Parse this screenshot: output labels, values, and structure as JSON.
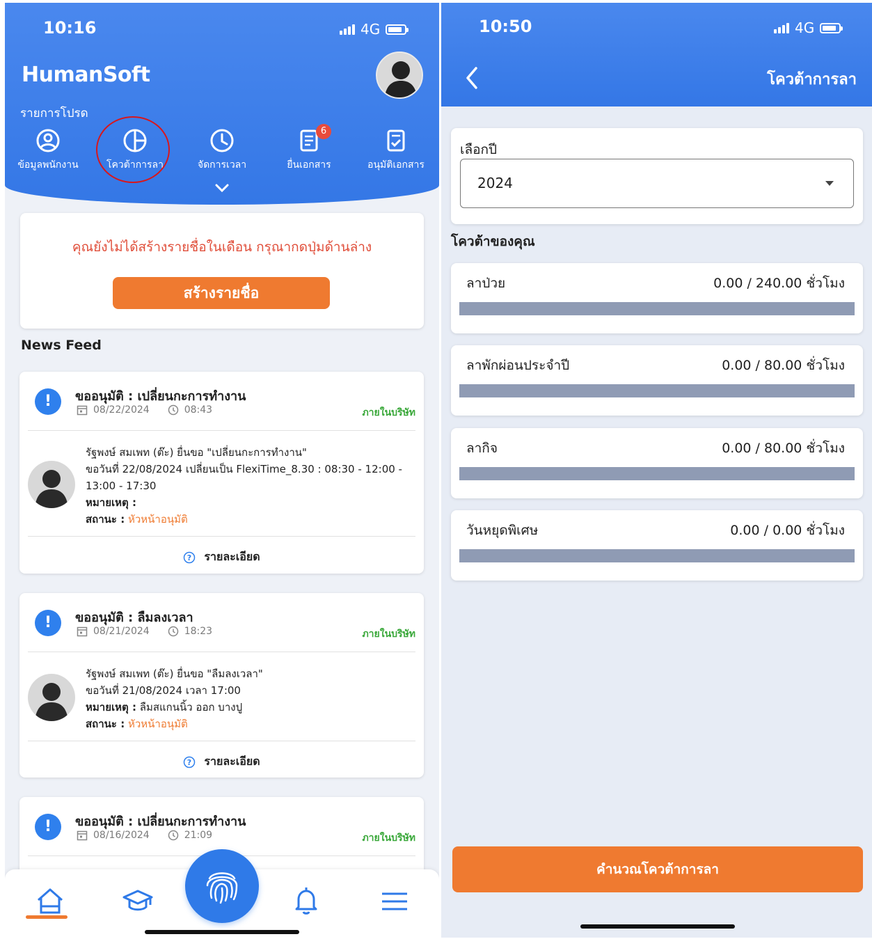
{
  "left": {
    "status": {
      "time": "10:16",
      "network": "4G"
    },
    "brand": "HumanSoft",
    "favorites_label": "รายการโปรด",
    "quick_menu": [
      {
        "label": "ข้อมูลพนักงาน",
        "icon": "user-circle-icon"
      },
      {
        "label": "โควต้าการลา",
        "icon": "pie-chart-icon"
      },
      {
        "label": "จัดการเวลา",
        "icon": "clock-icon"
      },
      {
        "label": "ยื่นเอกสาร",
        "icon": "document-icon",
        "badge": "6"
      },
      {
        "label": "อนุมัติเอกสาร",
        "icon": "approve-document-icon"
      }
    ],
    "notice": {
      "message": "คุณยังไม่ได้สร้างรายชื่อในเดือน กรุณากดปุ่มด้านล่าง",
      "button": "สร้างรายชื่อ"
    },
    "newsfeed_title": "News Feed",
    "news": [
      {
        "title": "ขออนุมัติ : เปลี่ยนกะการทำงาน",
        "date": "08/22/2024",
        "time": "08:43",
        "scope": "ภายในบริษัท",
        "line1": "รัฐพงษ์ สมเพท (ต๊ะ) ยื่นขอ \"เปลี่ยนกะการทำงาน\"",
        "line2": "ขอวันที่ 22/08/2024 เปลี่ยนเป็น FlexiTime_8.30 : 08:30 - 12:00 -",
        "line3": "13:00 - 17:30",
        "note_label": "หมายเหตุ :",
        "note_value": "",
        "status_label": "สถานะ :",
        "status_value": "หัวหน้าอนุมัติ",
        "detail": "รายละเอียด"
      },
      {
        "title": "ขออนุมัติ : ลืมลงเวลา",
        "date": "08/21/2024",
        "time": "18:23",
        "scope": "ภายในบริษัท",
        "line1": "รัฐพงษ์ สมเพท (ต๊ะ) ยื่นขอ \"ลืมลงเวลา\"",
        "line2": "ขอวันที่ 21/08/2024 เวลา 17:00",
        "note_label": "หมายเหตุ :",
        "note_value": "ลืมสแกนนิ้ว ออก บางปู",
        "status_label": "สถานะ :",
        "status_value": "หัวหน้าอนุมัติ",
        "detail": "รายละเอียด"
      },
      {
        "title": "ขออนุมัติ : เปลี่ยนกะการทำงาน",
        "date": "08/16/2024",
        "time": "21:09",
        "scope": "ภายในบริษัท"
      }
    ],
    "tabbar": [
      "home-icon",
      "graduation-cap-icon",
      "fingerprint-icon",
      "bell-icon",
      "menu-icon"
    ]
  },
  "right": {
    "status": {
      "time": "10:50",
      "network": "4G"
    },
    "title": "โควต้าการลา",
    "year_label": "เลือกปี",
    "year_value": "2024",
    "quota_heading": "โควต้าของคุณ",
    "quotas": [
      {
        "name": "ลาป่วย",
        "value": "0.00 / 240.00 ชั่วโมง",
        "used_fraction": 0
      },
      {
        "name": "ลาพักผ่อนประจำปี",
        "value": "0.00 / 80.00 ชั่วโมง",
        "used_fraction": 0
      },
      {
        "name": "ลากิจ",
        "value": "0.00 / 80.00 ชั่วโมง",
        "used_fraction": 0
      },
      {
        "name": "วันหยุดพิเศษ",
        "value": "0.00 / 0.00 ชั่วโมง",
        "used_fraction": 0
      }
    ],
    "calc_button": "คำนวณโควต้าการลา"
  },
  "colors": {
    "primary_blue": "#3477e6",
    "accent_orange": "#ef7a30",
    "scope_green": "#3aa83a",
    "warning_red": "#e04e3a",
    "bar_gray": "#8f9bb4"
  }
}
